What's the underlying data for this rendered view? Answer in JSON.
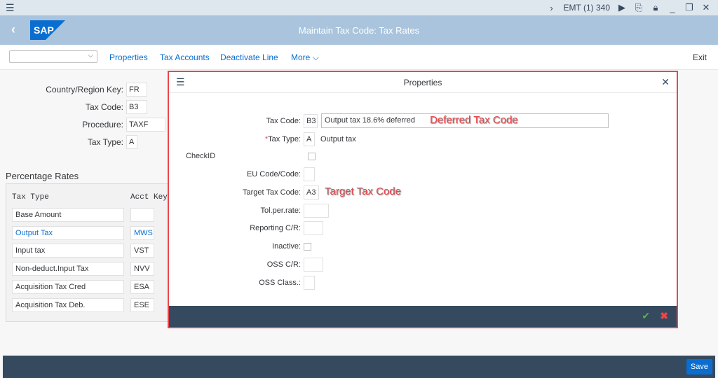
{
  "system_bar": {
    "system_label": "EMT (1) 340"
  },
  "shell": {
    "title": "Maintain Tax Code: Tax Rates",
    "logo_text": "SAP"
  },
  "toolbar": {
    "select_value": "",
    "buttons": [
      "Properties",
      "Tax Accounts",
      "Deactivate Line",
      "More"
    ],
    "exit_label": "Exit"
  },
  "header_fields": [
    {
      "label": "Country/Region Key:",
      "value": "FR"
    },
    {
      "label": "Tax Code:",
      "value": "B3"
    },
    {
      "label": "Procedure:",
      "value": "TAXF"
    },
    {
      "label": "Tax Type:",
      "value": "A"
    }
  ],
  "rates": {
    "section_title": "Percentage Rates",
    "col_tax_type": "Tax Type",
    "col_acct_key": "Acct Key",
    "rows": [
      {
        "tax_type": "Base Amount",
        "acct_key": ""
      },
      {
        "tax_type": "Output Tax",
        "acct_key": "MWS"
      },
      {
        "tax_type": "Input tax",
        "acct_key": "VST"
      },
      {
        "tax_type": "Non-deduct.Input Tax",
        "acct_key": "NVV"
      },
      {
        "tax_type": "Acquisition Tax Cred",
        "acct_key": "ESA"
      },
      {
        "tax_type": "Acquisition Tax Deb.",
        "acct_key": "ESE"
      }
    ]
  },
  "dialog": {
    "title": "Properties",
    "tax_code_label": "Tax Code:",
    "tax_code_value": "B3",
    "tax_code_description": "Output tax 18.6% deferred",
    "tax_type_required": "*",
    "tax_type_label": "Tax Type:",
    "tax_type_value": "A",
    "tax_type_text": "Output tax",
    "checkid_label": "CheckID",
    "eu_code_label": "EU Code/Code:",
    "eu_code_value": "",
    "target_tax_code_label": "Target Tax Code:",
    "target_tax_code_value": "A3",
    "tol_per_rate_label": "Tol.per.rate:",
    "tol_per_rate_value": "",
    "reporting_cr_label": "Reporting C/R:",
    "reporting_cr_value": "",
    "inactive_label": "Inactive:",
    "oss_cr_label": "OSS C/R:",
    "oss_cr_value": "",
    "oss_class_label": "OSS Class.:",
    "oss_class_value": ""
  },
  "annotations": {
    "deferred": "Deferred Tax Code",
    "target": "Target Tax Code"
  },
  "bottom_bar": {
    "save_label": "Save"
  },
  "colors": {
    "shell_bg": "#a9c4dc",
    "link": "#0a6ed1",
    "footer_bg": "#354a5f",
    "highlight_red": "#e8474d"
  }
}
